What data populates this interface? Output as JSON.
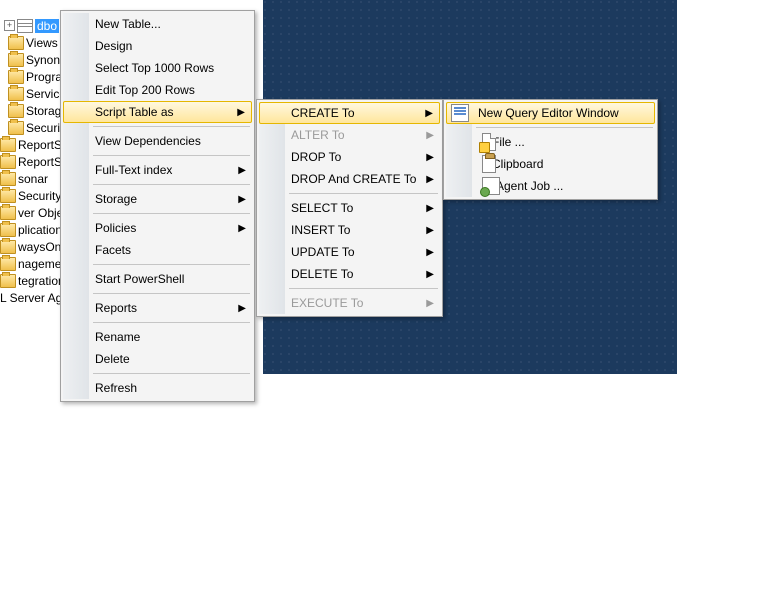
{
  "tree": {
    "items": [
      {
        "icon": "expand",
        "label": "",
        "indent": 4
      },
      {
        "icon": "table",
        "label": "dbo",
        "selected": true,
        "expand": true,
        "indent": 4
      },
      {
        "icon": "folder",
        "label": "Views",
        "indent": 8
      },
      {
        "icon": "folder",
        "label": "Synony",
        "indent": 8
      },
      {
        "icon": "folder",
        "label": "Program",
        "indent": 8
      },
      {
        "icon": "folder",
        "label": "Service",
        "indent": 8
      },
      {
        "icon": "folder",
        "label": "Storage",
        "indent": 8
      },
      {
        "icon": "folder",
        "label": "Security",
        "indent": 8
      },
      {
        "icon": "folder",
        "label": "ReportServ",
        "indent": 0
      },
      {
        "icon": "folder",
        "label": "ReportServ",
        "indent": 0
      },
      {
        "icon": "folder",
        "label": "sonar",
        "indent": 0
      },
      {
        "icon": "folder",
        "label": "Security",
        "indent": 0
      },
      {
        "icon": "folder",
        "label": "ver Objects",
        "indent": -14
      },
      {
        "icon": "folder",
        "label": "plication",
        "indent": -14
      },
      {
        "icon": "folder",
        "label": "waysOn High",
        "indent": -14
      },
      {
        "icon": "folder",
        "label": "nagement",
        "indent": -14
      },
      {
        "icon": "folder",
        "label": "tegration Ser",
        "indent": -14
      },
      {
        "icon": "none",
        "label": "L Server Age",
        "indent": -14
      }
    ]
  },
  "menu1": {
    "groups": [
      [
        {
          "label": "New Table...",
          "arrow": false
        },
        {
          "label": "Design",
          "arrow": false
        },
        {
          "label": "Select Top 1000 Rows",
          "arrow": false
        },
        {
          "label": "Edit Top 200 Rows",
          "arrow": false
        },
        {
          "label": "Script Table as",
          "arrow": true,
          "highlighted": true
        }
      ],
      [
        {
          "label": "View Dependencies",
          "arrow": false
        }
      ],
      [
        {
          "label": "Full-Text index",
          "arrow": true
        }
      ],
      [
        {
          "label": "Storage",
          "arrow": true
        }
      ],
      [
        {
          "label": "Policies",
          "arrow": true
        },
        {
          "label": "Facets",
          "arrow": false
        }
      ],
      [
        {
          "label": "Start PowerShell",
          "arrow": false
        }
      ],
      [
        {
          "label": "Reports",
          "arrow": true
        }
      ],
      [
        {
          "label": "Rename",
          "arrow": false
        },
        {
          "label": "Delete",
          "arrow": false
        }
      ],
      [
        {
          "label": "Refresh",
          "arrow": false
        }
      ]
    ]
  },
  "menu2": {
    "groups": [
      [
        {
          "label": "CREATE To",
          "arrow": true,
          "highlighted": true
        },
        {
          "label": "ALTER To",
          "arrow": true,
          "disabled": true
        },
        {
          "label": "DROP To",
          "arrow": true
        },
        {
          "label": "DROP And CREATE To",
          "arrow": true
        }
      ],
      [
        {
          "label": "SELECT To",
          "arrow": true
        },
        {
          "label": "INSERT To",
          "arrow": true
        },
        {
          "label": "UPDATE To",
          "arrow": true
        },
        {
          "label": "DELETE To",
          "arrow": true
        }
      ],
      [
        {
          "label": "EXECUTE To",
          "arrow": true,
          "disabled": true
        }
      ]
    ]
  },
  "menu3": {
    "groups": [
      [
        {
          "label": "New Query Editor Window",
          "icon": "new-query",
          "highlighted": true
        }
      ],
      [
        {
          "label": "File ...",
          "icon": "file"
        },
        {
          "label": "Clipboard",
          "icon": "clipboard"
        },
        {
          "label": "Agent Job ...",
          "icon": "agent"
        }
      ]
    ]
  }
}
